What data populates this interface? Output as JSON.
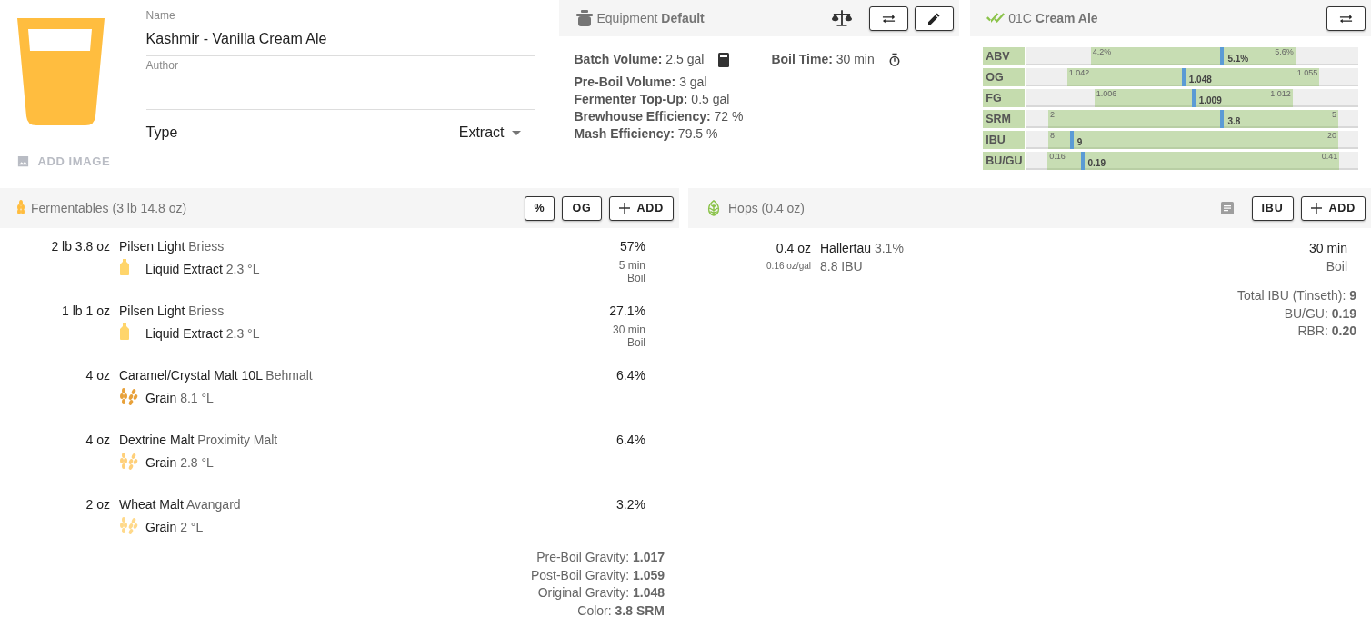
{
  "recipe": {
    "add_image": "ADD IMAGE",
    "name": {
      "label": "Name",
      "value": "Kashmir - Vanilla Cream Ale"
    },
    "author": {
      "label": "Author"
    },
    "type": {
      "label": "Type",
      "value": "Extract"
    }
  },
  "equipment": {
    "title": "Equipment **Default**",
    "stats_top": [
      "**Batch Volume:** 2.5 gal",
      "**Boil Time:** 30 min"
    ],
    "stats": [
      "**Pre-Boil Volume:** 3 gal",
      "**Fermenter Top-Up:** 0.5 gal",
      "**Brewhouse Efficiency:** 72 %",
      "**Mash Efficiency:** 79.5 %"
    ]
  },
  "style": {
    "title": "01C **Cream Ale**",
    "ranges": [
      {
        "label": "ABV",
        "low": {
          "text": "4.2%",
          "level": 0.193
        },
        "high": {
          "text": "5.6%",
          "level": 0.81
        },
        "value": {
          "text": "5.1%",
          "level": 0.59
        }
      },
      {
        "label": "OG",
        "low": {
          "text": "1.042",
          "level": 0.122
        },
        "high": {
          "text": "1.055",
          "level": 0.883
        },
        "value": {
          "text": "1.048",
          "level": 0.473
        }
      },
      {
        "label": "FG",
        "low": {
          "text": "1.006",
          "level": 0.204
        },
        "high": {
          "text": "1.012",
          "level": 0.802
        },
        "value": {
          "text": "1.009",
          "level": 0.503
        }
      },
      {
        "label": "SRM",
        "low": {
          "text": "2",
          "level": 0.065
        },
        "high": {
          "text": "5",
          "level": 0.94
        },
        "value": {
          "text": "3.8",
          "level": 0.59
        }
      },
      {
        "label": "IBU",
        "low": {
          "text": "8",
          "level": 0.065
        },
        "high": {
          "text": "20",
          "level": 0.94
        },
        "value": {
          "text": "9",
          "level": 0.136
        }
      },
      {
        "label": "BU/GU",
        "low": {
          "text": "0.16",
          "level": 0.063
        },
        "high": {
          "text": "0.41",
          "level": 0.943
        },
        "value": {
          "text": "0.19",
          "level": 0.168
        }
      }
    ]
  },
  "fermentables": {
    "title": "Fermentables (3 lb 14.8 oz)",
    "buttons": [
      "%",
      "OG"
    ],
    "add": "ADD",
    "rows": [
      {
        "amount": "2 lb 3.8 oz",
        "name": "Pilsen Light",
        "supplier": "Briess",
        "kind": "extract",
        "color": "#ffd56b",
        "type": "Liquid Extract",
        "lovibond": "2.3 °L",
        "percent": "57%",
        "time": "5 min",
        "use": "Boil"
      },
      {
        "amount": "1 lb 1 oz",
        "name": "Pilsen Light",
        "supplier": "Briess",
        "kind": "extract",
        "color": "#ffd56b",
        "type": "Liquid Extract",
        "lovibond": "2.3 °L",
        "percent": "27.1%",
        "time": "30 min",
        "use": "Boil"
      },
      {
        "amount": "4 oz",
        "name": "Caramel/Crystal Malt 10L",
        "supplier": "Behmalt",
        "kind": "grain",
        "color": "#e8a13a",
        "type": "Grain",
        "lovibond": "8.1 °L",
        "percent": "6.4%"
      },
      {
        "amount": "4 oz",
        "name": "Dextrine Malt",
        "supplier": "Proximity Malt",
        "kind": "grain",
        "color": "#ffd07a",
        "type": "Grain",
        "lovibond": "2.8 °L",
        "percent": "6.4%"
      },
      {
        "amount": "2 oz",
        "name": "Wheat Malt",
        "supplier": "Avangard",
        "kind": "grain",
        "color": "#ffd98a",
        "type": "Grain",
        "lovibond": "2 °L",
        "percent": "3.2%"
      }
    ],
    "totals": [
      "Pre-Boil Gravity: **1.017**",
      "Post-Boil Gravity: **1.059**",
      "Original Gravity: **1.048**",
      "Color: **3.8 SRM**"
    ]
  },
  "hops": {
    "title": "Hops (0.4 oz)",
    "buttons": [
      "IBU"
    ],
    "add": "ADD",
    "rows": [
      {
        "amount": "0.4 oz",
        "per_gal": "0.16 oz/gal",
        "name": "Hallertau",
        "alpha": "3.1%",
        "ibu": "8.8 IBU",
        "time": "30 min",
        "use": "Boil"
      }
    ],
    "totals": [
      "Total IBU (Tinseth): **9**",
      "BU/GU: **0.19**",
      "RBR: **0.20**"
    ]
  }
}
